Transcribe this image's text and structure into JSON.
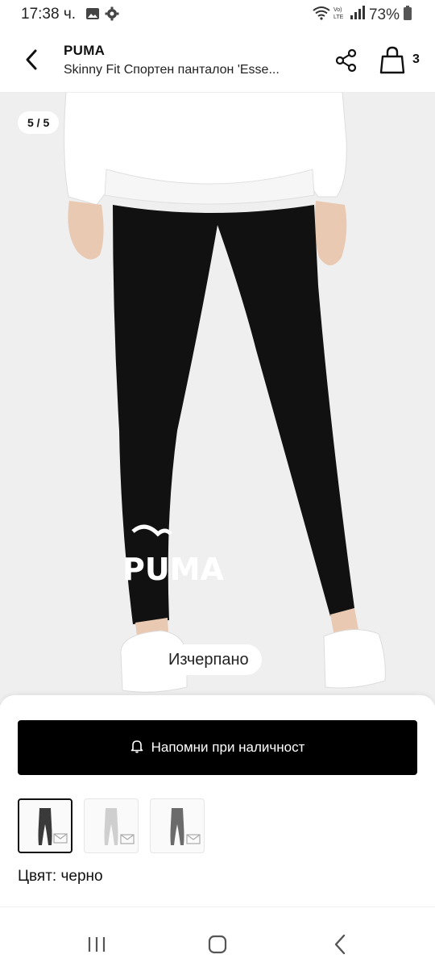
{
  "status_bar": {
    "time": "17:38 ч.",
    "battery": "73%",
    "icons": [
      "gallery-icon",
      "gear-icon",
      "wifi-icon",
      "volte-icon",
      "signal-icon",
      "battery-icon"
    ]
  },
  "header": {
    "brand": "PUMA",
    "title": "Skinny Fit Спортен панталон 'Esse...",
    "bag_count": "3",
    "icons": [
      "back-arrow-icon",
      "share-icon",
      "shopping-bag-icon"
    ]
  },
  "gallery": {
    "counter": "5 / 5",
    "availability": "Изчерпано",
    "logo_text": "PUMA"
  },
  "sheet": {
    "notify_label": "Напомни при наличност",
    "notify_icon": "bell-icon",
    "swatches": [
      {
        "name": "black",
        "selected": true,
        "color": "#3a3a3a"
      },
      {
        "name": "light-grey",
        "selected": false,
        "color": "#cfcfcf"
      },
      {
        "name": "dark-grey",
        "selected": false,
        "color": "#6b6b6b"
      }
    ],
    "color_label": "Цвят: черно"
  },
  "navbar": {
    "icons": [
      "recent-apps-icon",
      "home-icon",
      "back-icon"
    ]
  }
}
